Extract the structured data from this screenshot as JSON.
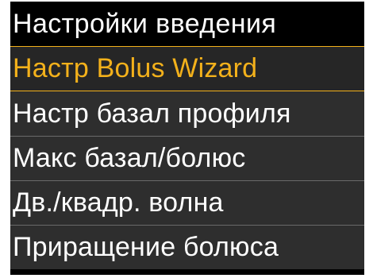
{
  "header": {
    "title": "Настройки введения"
  },
  "menu": {
    "items": [
      {
        "label": "Настр Bolus Wizard",
        "selected": true
      },
      {
        "label": "Настр базал профиля",
        "selected": false
      },
      {
        "label": "Макс базал/болюс",
        "selected": false
      },
      {
        "label": "Дв./квадр. волна",
        "selected": false
      },
      {
        "label": "Приращение болюса",
        "selected": false
      }
    ]
  },
  "colors": {
    "background": "#000000",
    "item_background": "#2e2e2e",
    "selection_accent": "#f3b11b",
    "text": "#ffffff"
  }
}
